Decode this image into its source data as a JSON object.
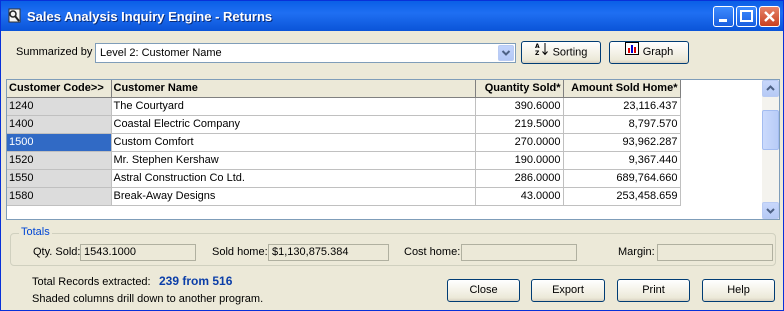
{
  "window": {
    "title": "Sales Analysis Inquiry Engine - Returns"
  },
  "toolbar": {
    "summarized_by_label": "Summarized by",
    "summarized_by_value": "Level 2: Customer Name",
    "sorting_label": "Sorting",
    "graph_label": "Graph"
  },
  "grid": {
    "columns": [
      "Customer Code>>",
      "Customer Name",
      "Quantity Sold*",
      "Amount Sold Home*"
    ],
    "rows": [
      {
        "code": "1240",
        "name": "The Courtyard",
        "qty": "390.6000",
        "amount": "23,116.437"
      },
      {
        "code": "1400",
        "name": "Coastal Electric Company",
        "qty": "219.5000",
        "amount": "8,797.570"
      },
      {
        "code": "1500",
        "name": "Custom Comfort",
        "qty": "270.0000",
        "amount": "93,962.287"
      },
      {
        "code": "1520",
        "name": "Mr. Stephen Kershaw",
        "qty": "190.0000",
        "amount": "9,367.440"
      },
      {
        "code": "1550",
        "name": "Astral Construction Co Ltd.",
        "qty": "286.0000",
        "amount": "689,764.660"
      },
      {
        "code": "1580",
        "name": "Break-Away Designs",
        "qty": "43.0000",
        "amount": "253,458.659"
      }
    ],
    "selected_row_index": 2
  },
  "totals": {
    "legend": "Totals",
    "qty_sold_label": "Qty. Sold:",
    "qty_sold_value": "1543.1000",
    "sold_home_label": "Sold home:",
    "sold_home_value": "$1,130,875.384",
    "cost_home_label": "Cost home:",
    "cost_home_value": "",
    "margin_label": "Margin:",
    "margin_value": ""
  },
  "footer": {
    "records_label": "Total Records extracted:",
    "records_value": "239 from 516",
    "note": "Shaded columns drill down to another program.",
    "close_label": "Close",
    "export_label": "Export",
    "print_label": "Print",
    "help_label": "Help"
  },
  "colors": {
    "title_bar": "#0a5fe6",
    "selection": "#316ac5",
    "records_text": "#0b3ea8",
    "legend_text": "#0046d5"
  }
}
